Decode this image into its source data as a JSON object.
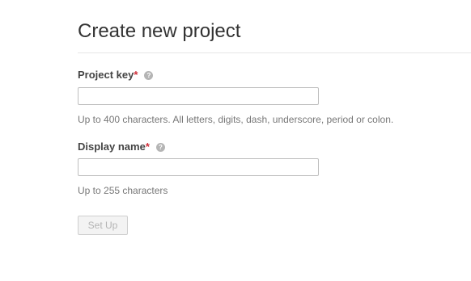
{
  "page": {
    "title": "Create new project"
  },
  "form": {
    "project_key": {
      "label": "Project key",
      "required_mark": "*",
      "help_icon": "question-circle-icon",
      "value": "",
      "placeholder": "",
      "hint": "Up to 400 characters. All letters, digits, dash, underscore, period or colon."
    },
    "display_name": {
      "label": "Display name",
      "required_mark": "*",
      "help_icon": "question-circle-icon",
      "value": "",
      "placeholder": "",
      "hint": "Up to 255 characters"
    },
    "submit": {
      "label": "Set Up",
      "state": "disabled"
    }
  },
  "colors": {
    "required": "#d02f3a",
    "help_icon": "#b5b5b5",
    "hint_text": "#777777",
    "button_disabled_bg": "#f3f3f3",
    "button_disabled_text": "#b4b4b4"
  }
}
